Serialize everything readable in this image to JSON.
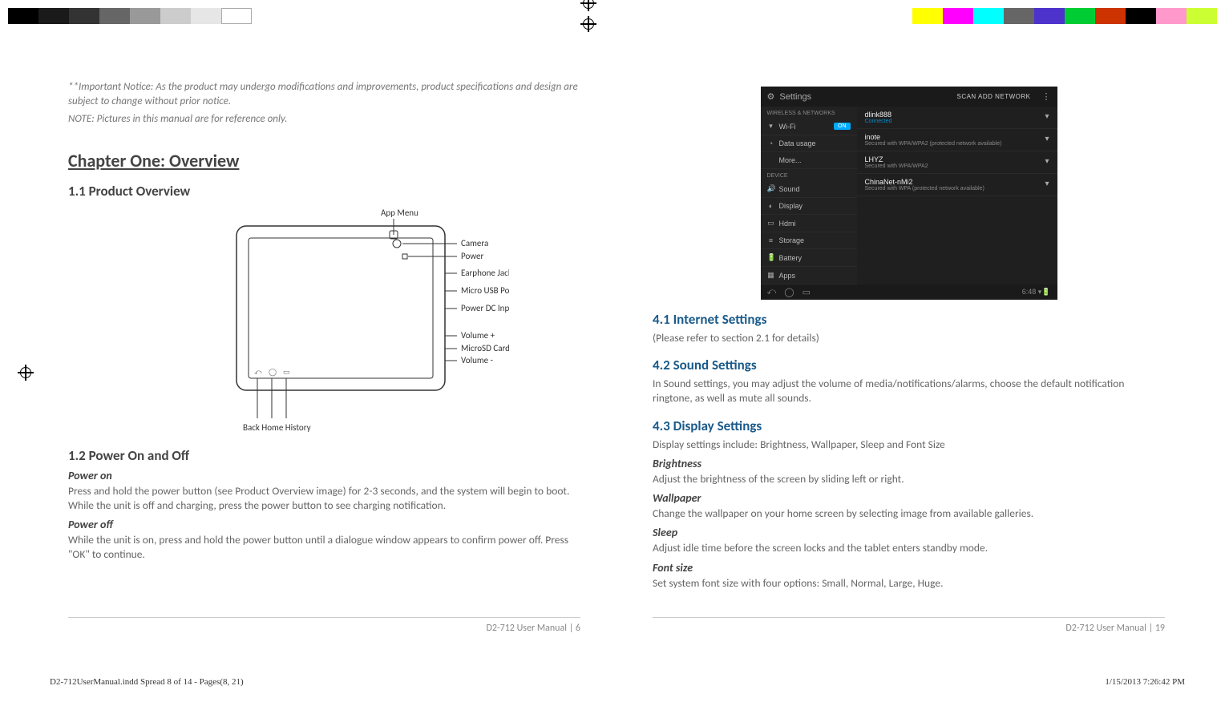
{
  "left_page": {
    "notice1": "**Important Notice: As the product may undergo modifications and improvements, product specifications and design are subject to change without prior notice.",
    "notice2": "NOTE: Pictures in this manual are for reference only.",
    "chapter_title": "Chapter One: Overview",
    "section_1_1": "1.1 Product Overview",
    "diagram": {
      "top_label": "App Menu",
      "right_labels": [
        "Camera",
        "Power",
        "Earphone Jack",
        "Micro USB Port",
        "Power DC Input",
        "Volume +",
        "MicroSD Card",
        "Volume -"
      ],
      "bottom_labels": "Back  Home  History"
    },
    "section_1_2": "1.2 Power On and Off",
    "power_on_label": "Power on",
    "power_on_text": "Press and hold the power button (see Product Overview image) for 2-3 seconds, and the system will begin to boot. While the unit is off and charging, press the power button to see charging notification.",
    "power_off_label": "Power off",
    "power_off_text": "While the unit is on, press and hold the power button until a dialogue window appears to confirm power off. Press \"OK\" to continue.",
    "footer": "D2-712 User Manual | 6"
  },
  "right_page": {
    "settings": {
      "title": "Settings",
      "actions": "SCAN    ADD NETWORK",
      "cat_wireless": "WIRELESS & NETWORKS",
      "wifi_label": "Wi-Fi",
      "wifi_toggle": "ON",
      "data_usage": "Data usage",
      "more": "More...",
      "cat_device": "DEVICE",
      "sound": "Sound",
      "display": "Display",
      "hdmi": "Hdmi",
      "storage": "Storage",
      "battery": "Battery",
      "apps": "Apps",
      "net1_name": "dlink888",
      "net1_sub": "Connected",
      "net2_name": "inote",
      "net2_sub": "Secured with WPA/WPA2 (protected network available)",
      "net3_name": "LHYZ",
      "net3_sub": "Secured with WPA/WPA2",
      "net4_name": "ChinaNet-nMi2",
      "net4_sub": "Secured with WPA (protected network available)",
      "time": "6:48"
    },
    "section_4_1": "4.1 Internet Settings",
    "text_4_1": "(Please refer to section 2.1 for details)",
    "section_4_2": "4.2 Sound Settings",
    "text_4_2": "In Sound settings, you may adjust the volume of media/notifications/alarms, choose the default notification ringtone, as well as mute all sounds.",
    "section_4_3": "4.3 Display Settings",
    "text_4_3": "Display settings include: Brightness, Wallpaper, Sleep and Font Size",
    "brightness_label": "Brightness",
    "brightness_text": "Adjust the brightness of the screen by sliding left or right.",
    "wallpaper_label": "Wallpaper",
    "wallpaper_text": "Change the wallpaper on your home screen by selecting image from available galleries.",
    "sleep_label": "Sleep",
    "sleep_text": "Adjust idle time before the screen locks and the tablet enters standby mode.",
    "fontsize_label": "Font size",
    "fontsize_text": "Set system font size with four options: Small, Normal, Large, Huge.",
    "footer": "D2-712 User Manual | 19"
  },
  "print_info": {
    "file": "D2-712UserManual.indd   Spread 8 of 14 - Pages(8, 21)",
    "timestamp": "1/15/2013   7:26:42 PM"
  }
}
